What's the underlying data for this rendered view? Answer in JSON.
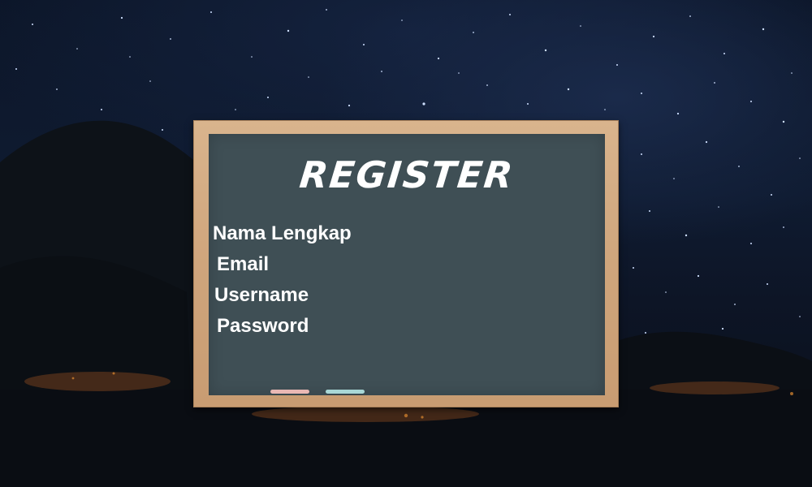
{
  "register_form": {
    "title": "REGISTER",
    "fields": [
      {
        "label": "Nama Lengkap"
      },
      {
        "label": "Email"
      },
      {
        "label": "Username"
      },
      {
        "label": "Password"
      }
    ]
  },
  "colors": {
    "sky": "#0f1b31",
    "chalkboard": "#3f4f55",
    "frame_wood": "#cfa57c",
    "text": "#ffffff",
    "chalk_pink": "#e9b8b4",
    "chalk_blue": "#a9d8d6"
  }
}
